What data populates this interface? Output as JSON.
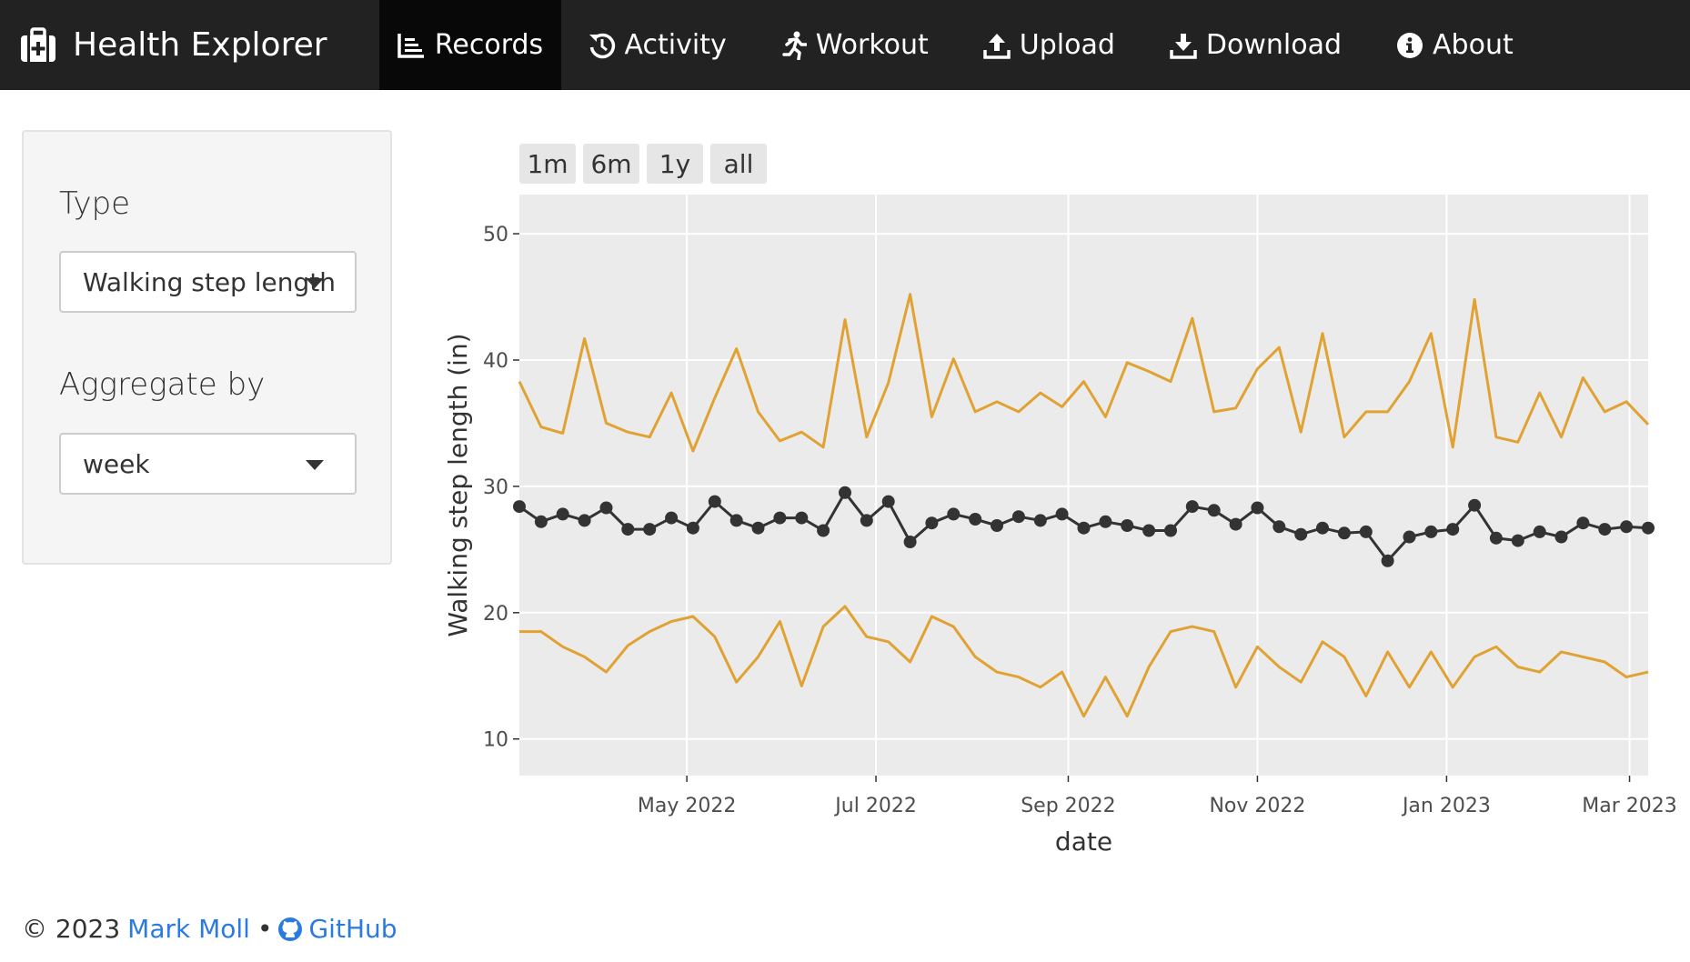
{
  "navbar": {
    "brand": {
      "text": "Health Explorer",
      "icon": "medkit-icon"
    },
    "items": [
      {
        "label": "Records",
        "icon": "list-chart-icon",
        "active": true
      },
      {
        "label": "Activity",
        "icon": "history-icon",
        "active": false
      },
      {
        "label": "Workout",
        "icon": "running-icon",
        "active": false
      },
      {
        "label": "Upload",
        "icon": "upload-icon",
        "active": false
      },
      {
        "label": "Download",
        "icon": "download-icon",
        "active": false
      },
      {
        "label": "About",
        "icon": "info-icon",
        "active": false
      }
    ]
  },
  "sidebar": {
    "type_label": "Type",
    "type_value": "Walking step length",
    "aggregate_label": "Aggregate by",
    "aggregate_value": "week"
  },
  "range_buttons": [
    "1m",
    "6m",
    "1y",
    "all"
  ],
  "chart_data": {
    "type": "line",
    "xlabel": "date",
    "ylabel": "Walking step length (in)",
    "ylim": [
      7.1,
      53.1
    ],
    "xlim": [
      "2022-03-08",
      "2023-03-07"
    ],
    "yticks": [
      10,
      20,
      30,
      40,
      50
    ],
    "xticks": [
      {
        "date": "2022-05-01",
        "label": "May 2022"
      },
      {
        "date": "2022-07-01",
        "label": "Jul 2022"
      },
      {
        "date": "2022-09-01",
        "label": "Sep 2022"
      },
      {
        "date": "2022-11-01",
        "label": "Nov 2022"
      },
      {
        "date": "2023-01-01",
        "label": "Jan 2023"
      },
      {
        "date": "2023-03-01",
        "label": "Mar 2023"
      }
    ],
    "grid": true,
    "background": "#ebebeb",
    "dates": [
      "2022-03-08",
      "2022-03-15",
      "2022-03-22",
      "2022-03-29",
      "2022-04-05",
      "2022-04-12",
      "2022-04-19",
      "2022-04-26",
      "2022-05-03",
      "2022-05-10",
      "2022-05-17",
      "2022-05-24",
      "2022-05-31",
      "2022-06-07",
      "2022-06-14",
      "2022-06-21",
      "2022-06-28",
      "2022-07-05",
      "2022-07-12",
      "2022-07-19",
      "2022-07-26",
      "2022-08-02",
      "2022-08-09",
      "2022-08-16",
      "2022-08-23",
      "2022-08-30",
      "2022-09-06",
      "2022-09-13",
      "2022-09-20",
      "2022-09-27",
      "2022-10-04",
      "2022-10-11",
      "2022-10-18",
      "2022-10-25",
      "2022-11-01",
      "2022-11-08",
      "2022-11-15",
      "2022-11-22",
      "2022-11-29",
      "2022-12-06",
      "2022-12-13",
      "2022-12-20",
      "2022-12-27",
      "2023-01-03",
      "2023-01-10",
      "2023-01-17",
      "2023-01-24",
      "2023-01-31",
      "2023-02-07",
      "2023-02-14",
      "2023-02-21",
      "2023-02-28",
      "2023-03-07"
    ],
    "series": [
      {
        "role": "upper",
        "color": "#e0a232",
        "markers": false,
        "values": [
          38.3,
          34.7,
          34.2,
          41.7,
          35.0,
          34.3,
          33.9,
          37.4,
          32.8,
          37.0,
          40.9,
          35.9,
          33.6,
          34.3,
          33.1,
          43.2,
          33.9,
          38.2,
          45.2,
          35.5,
          40.1,
          35.9,
          36.7,
          35.9,
          37.4,
          36.3,
          38.3,
          35.5,
          39.8,
          39.1,
          38.3,
          43.3,
          35.9,
          36.2,
          39.3,
          41.0,
          34.3,
          42.1,
          33.9,
          35.9,
          35.9,
          38.3,
          42.1,
          33.1,
          44.8,
          33.9,
          33.5,
          37.4,
          33.9,
          38.6,
          35.9,
          36.7,
          34.9
        ]
      },
      {
        "role": "mean",
        "color": "#333333",
        "markers": true,
        "values": [
          28.4,
          27.2,
          27.8,
          27.3,
          28.3,
          26.6,
          26.6,
          27.5,
          26.7,
          28.8,
          27.3,
          26.7,
          27.5,
          27.5,
          26.5,
          29.5,
          27.3,
          28.8,
          25.6,
          27.1,
          27.8,
          27.4,
          26.9,
          27.6,
          27.3,
          27.8,
          26.7,
          27.2,
          26.9,
          26.5,
          26.5,
          28.4,
          28.1,
          27.0,
          28.3,
          26.8,
          26.2,
          26.7,
          26.3,
          26.4,
          24.1,
          26.0,
          26.4,
          26.6,
          28.5,
          25.9,
          25.7,
          26.4,
          26.0,
          27.1,
          26.6,
          26.8,
          26.7
        ]
      },
      {
        "role": "lower",
        "color": "#e0a232",
        "markers": false,
        "values": [
          18.5,
          18.5,
          17.3,
          16.5,
          15.3,
          17.4,
          18.5,
          19.3,
          19.7,
          18.1,
          14.5,
          16.5,
          19.3,
          14.2,
          18.9,
          20.5,
          18.1,
          17.7,
          16.1,
          19.7,
          18.9,
          16.5,
          15.3,
          14.9,
          14.1,
          15.3,
          11.8,
          14.9,
          11.8,
          15.7,
          18.5,
          18.9,
          18.5,
          14.1,
          17.3,
          15.7,
          14.5,
          17.7,
          16.5,
          13.4,
          16.9,
          14.1,
          16.9,
          14.1,
          16.5,
          17.3,
          15.7,
          15.3,
          16.9,
          16.5,
          16.1,
          14.9,
          15.3
        ]
      }
    ]
  },
  "footer": {
    "copyright": "© 2023",
    "author": "Mark Moll",
    "separator": "•",
    "github": "GitHub"
  }
}
